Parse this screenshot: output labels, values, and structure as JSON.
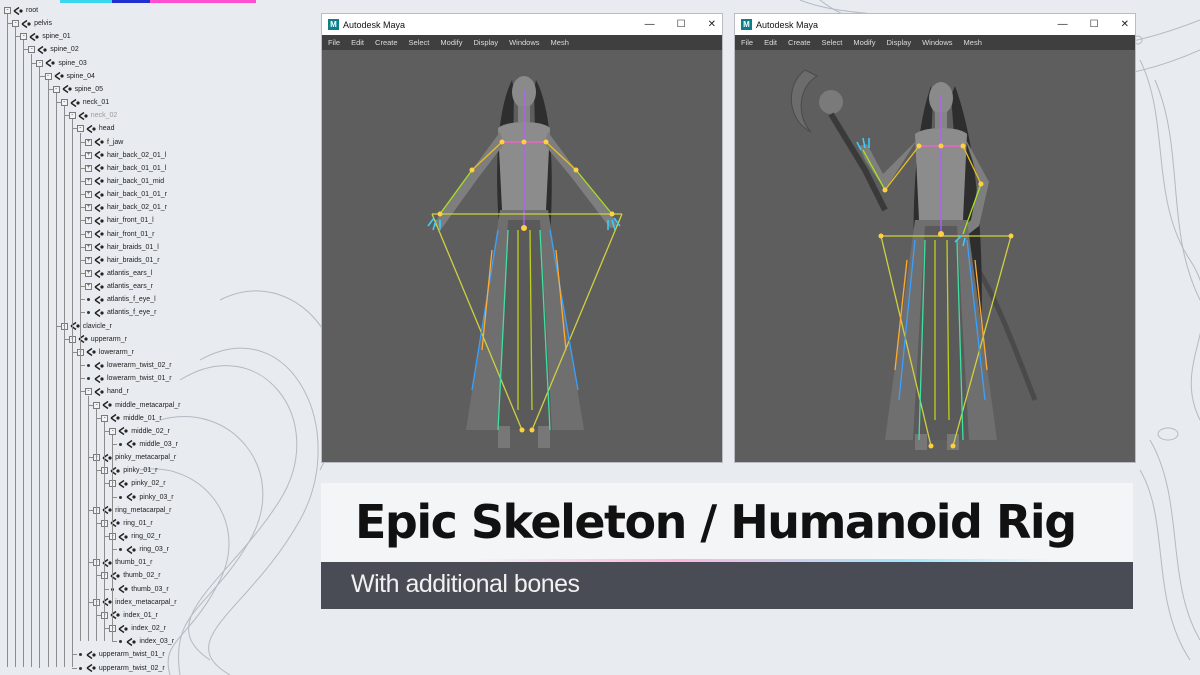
{
  "outliner": {
    "items": [
      {
        "label": "root",
        "depth": 0,
        "expander": "-"
      },
      {
        "label": "pelvis",
        "depth": 1,
        "expander": "-"
      },
      {
        "label": "spine_01",
        "depth": 2,
        "expander": "-"
      },
      {
        "label": "spine_02",
        "depth": 3,
        "expander": "-"
      },
      {
        "label": "spine_03",
        "depth": 4,
        "expander": "-"
      },
      {
        "label": "spine_04",
        "depth": 5,
        "expander": "-"
      },
      {
        "label": "spine_05",
        "depth": 6,
        "expander": "-"
      },
      {
        "label": "neck_01",
        "depth": 7,
        "expander": "-"
      },
      {
        "label": "neck_02",
        "depth": 8,
        "expander": "-",
        "dim": true
      },
      {
        "label": "head",
        "depth": 9,
        "expander": "-"
      },
      {
        "label": "f_jaw",
        "depth": 10,
        "expander": "+"
      },
      {
        "label": "hair_back_02_01_l",
        "depth": 10,
        "expander": "+"
      },
      {
        "label": "hair_back_01_01_l",
        "depth": 10,
        "expander": "+"
      },
      {
        "label": "hair_back_01_mid",
        "depth": 10,
        "expander": "+"
      },
      {
        "label": "hair_back_01_01_r",
        "depth": 10,
        "expander": "+"
      },
      {
        "label": "hair_back_02_01_r",
        "depth": 10,
        "expander": "+"
      },
      {
        "label": "hair_front_01_l",
        "depth": 10,
        "expander": "+"
      },
      {
        "label": "hair_front_01_r",
        "depth": 10,
        "expander": "+"
      },
      {
        "label": "hair_braids_01_l",
        "depth": 10,
        "expander": "+"
      },
      {
        "label": "hair_braids_01_r",
        "depth": 10,
        "expander": "+"
      },
      {
        "label": "atlantis_ears_l",
        "depth": 10,
        "expander": "+"
      },
      {
        "label": "atlantis_ears_r",
        "depth": 10,
        "expander": "+"
      },
      {
        "label": "atlantis_f_eye_l",
        "depth": 10,
        "expander": "."
      },
      {
        "label": "atlantis_f_eye_r",
        "depth": 10,
        "expander": "."
      },
      {
        "label": "clavicle_r",
        "depth": 7,
        "expander": "-"
      },
      {
        "label": "upperarm_r",
        "depth": 8,
        "expander": "-"
      },
      {
        "label": "lowerarm_r",
        "depth": 9,
        "expander": "-"
      },
      {
        "label": "lowerarm_twist_02_r",
        "depth": 10,
        "expander": "."
      },
      {
        "label": "lowerarm_twist_01_r",
        "depth": 10,
        "expander": "."
      },
      {
        "label": "hand_r",
        "depth": 10,
        "expander": "-"
      },
      {
        "label": "middle_metacarpal_r",
        "depth": 11,
        "expander": "-"
      },
      {
        "label": "middle_01_r",
        "depth": 12,
        "expander": "-"
      },
      {
        "label": "middle_02_r",
        "depth": 13,
        "expander": "-"
      },
      {
        "label": "middle_03_r",
        "depth": 14,
        "expander": "."
      },
      {
        "label": "pinky_metacarpal_r",
        "depth": 11,
        "expander": "-"
      },
      {
        "label": "pinky_01_r",
        "depth": 12,
        "expander": "-"
      },
      {
        "label": "pinky_02_r",
        "depth": 13,
        "expander": "-"
      },
      {
        "label": "pinky_03_r",
        "depth": 14,
        "expander": "."
      },
      {
        "label": "ring_metacarpal_r",
        "depth": 11,
        "expander": "-"
      },
      {
        "label": "ring_01_r",
        "depth": 12,
        "expander": "-"
      },
      {
        "label": "ring_02_r",
        "depth": 13,
        "expander": "-"
      },
      {
        "label": "ring_03_r",
        "depth": 14,
        "expander": "."
      },
      {
        "label": "thumb_01_r",
        "depth": 11,
        "expander": "-"
      },
      {
        "label": "thumb_02_r",
        "depth": 12,
        "expander": "-"
      },
      {
        "label": "thumb_03_r",
        "depth": 13,
        "expander": "."
      },
      {
        "label": "index_metacarpal_r",
        "depth": 11,
        "expander": "-"
      },
      {
        "label": "index_01_r",
        "depth": 12,
        "expander": "-"
      },
      {
        "label": "index_02_r",
        "depth": 13,
        "expander": "-"
      },
      {
        "label": "index_03_r",
        "depth": 14,
        "expander": "."
      },
      {
        "label": "upperarm_twist_01_r",
        "depth": 9,
        "expander": "."
      },
      {
        "label": "upperarm_twist_02_r",
        "depth": 9,
        "expander": "."
      }
    ]
  },
  "windows": [
    {
      "title": "Autodesk Maya",
      "menu": [
        "File",
        "Edit",
        "Create",
        "Select",
        "Modify",
        "Display",
        "Windows",
        "Mesh"
      ]
    },
    {
      "title": "Autodesk Maya",
      "menu": [
        "File",
        "Edit",
        "Create",
        "Select",
        "Modify",
        "Display",
        "Windows",
        "Mesh"
      ]
    }
  ],
  "window_controls": {
    "minimize": "—",
    "maximize": "☐",
    "close": "✕"
  },
  "heading": {
    "title": "Epic Skeleton / Humanoid Rig",
    "subtitle": "With additional bones"
  },
  "colors": {
    "background": "#e8ebef",
    "viewport": "#5e5e5e",
    "menubar": "#3f3f3f",
    "subtitle_bar": "#4a4c55",
    "accent_pink": "#ff4fd0",
    "accent_blue": "#2030d0",
    "accent_cyan": "#39d8f0"
  }
}
